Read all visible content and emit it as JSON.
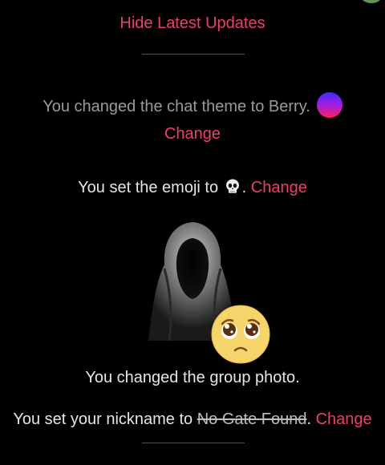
{
  "header": {
    "hide_updates_label": "Hide Latest Updates"
  },
  "updates": {
    "theme": {
      "text": "You changed the chat theme to Berry.",
      "change_label": "Change",
      "theme_icon": "berry-gradient-circle"
    },
    "emoji": {
      "text_before": "You set the emoji to",
      "emoji_icon": "skull-emoji",
      "text_after": ".",
      "change_label": "Change"
    },
    "group_photo": {
      "text": "You changed the group photo.",
      "photo_icon": "hooded-figure-photo",
      "sticker_icon": "pleading-face-emoji"
    },
    "nickname": {
      "text_before": "You set your nickname to ",
      "nickname": "No Gate Found",
      "text_after": ".",
      "change_label": "Change"
    }
  },
  "colors": {
    "accent": "#f23d6a",
    "background": "#000000",
    "muted_text": "#9a9a9a"
  }
}
